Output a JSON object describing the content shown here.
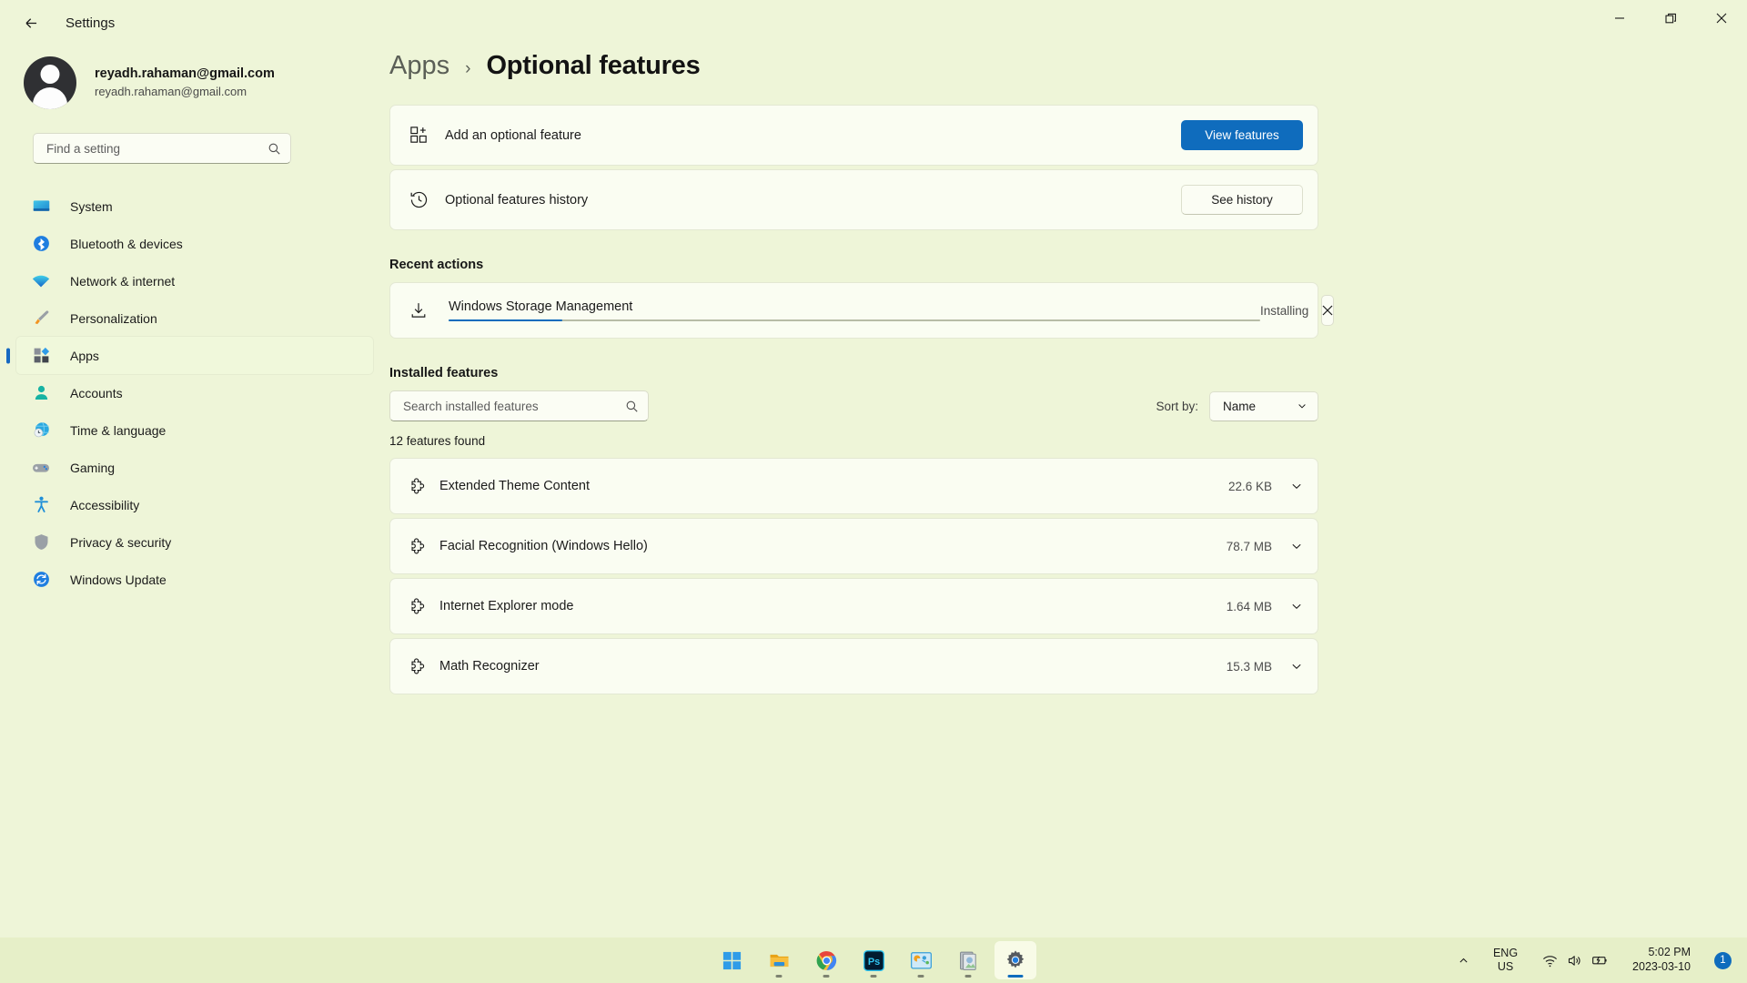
{
  "window": {
    "title": "Settings",
    "back_icon": "arrow-left-icon",
    "minimize_label": "–",
    "maximize_label": "❐",
    "close_label": "✕"
  },
  "account": {
    "name": "reyadh.rahaman@gmail.com",
    "email": "reyadh.rahaman@gmail.com"
  },
  "search": {
    "placeholder": "Find a setting"
  },
  "sidebar": {
    "items": [
      {
        "label": "System",
        "icon": "system-monitor-icon",
        "active": false
      },
      {
        "label": "Bluetooth & devices",
        "icon": "bluetooth-icon",
        "active": false
      },
      {
        "label": "Network & internet",
        "icon": "wifi-icon",
        "active": false
      },
      {
        "label": "Personalization",
        "icon": "paintbrush-icon",
        "active": false
      },
      {
        "label": "Apps",
        "icon": "apps-grid-icon",
        "active": true
      },
      {
        "label": "Accounts",
        "icon": "person-icon",
        "active": false
      },
      {
        "label": "Time & language",
        "icon": "clock-globe-icon",
        "active": false
      },
      {
        "label": "Gaming",
        "icon": "gamepad-icon",
        "active": false
      },
      {
        "label": "Accessibility",
        "icon": "accessibility-person-icon",
        "active": false
      },
      {
        "label": "Privacy & security",
        "icon": "shield-icon",
        "active": false
      },
      {
        "label": "Windows Update",
        "icon": "update-refresh-icon",
        "active": false
      }
    ]
  },
  "breadcrumb": {
    "parent": "Apps",
    "separator": "›",
    "current": "Optional features"
  },
  "cards": {
    "add_feature": {
      "label": "Add an optional feature",
      "icon": "add-grid-icon",
      "button": "View features"
    },
    "history": {
      "label": "Optional features history",
      "icon": "history-clock-icon",
      "button": "See history"
    }
  },
  "recent_actions": {
    "title": "Recent actions",
    "items": [
      {
        "name": "Windows Storage Management",
        "icon": "download-icon",
        "status": "Installing",
        "progress_percent": 14,
        "cancel_icon": "close-icon"
      }
    ]
  },
  "installed": {
    "title": "Installed features",
    "search_placeholder": "Search installed features",
    "search_icon": "search-icon",
    "sort_label": "Sort by:",
    "sort_value": "Name",
    "sort_chevron": "chevron-down-icon",
    "count_text": "12 features found",
    "rows": [
      {
        "name": "Extended Theme Content",
        "size": "22.6 KB",
        "icon": "puzzle-piece-icon"
      },
      {
        "name": "Facial Recognition (Windows Hello)",
        "size": "78.7 MB",
        "icon": "puzzle-piece-icon"
      },
      {
        "name": "Internet Explorer mode",
        "size": "1.64 MB",
        "icon": "puzzle-piece-icon"
      },
      {
        "name": "Math Recognizer",
        "size": "15.3 MB",
        "icon": "puzzle-piece-icon"
      }
    ]
  },
  "taskbar": {
    "items": [
      {
        "name": "start-button",
        "icon": "windows-logo-icon",
        "running": false,
        "active": false
      },
      {
        "name": "file-explorer",
        "icon": "folder-icon",
        "running": true,
        "active": false
      },
      {
        "name": "google-chrome",
        "icon": "chrome-icon",
        "running": true,
        "active": false
      },
      {
        "name": "photoshop",
        "icon": "photoshop-icon",
        "running": true,
        "active": false
      },
      {
        "name": "presentation-app",
        "icon": "presentation-icon",
        "running": true,
        "active": false
      },
      {
        "name": "media-app",
        "icon": "media-icon",
        "running": true,
        "active": false
      },
      {
        "name": "settings-app",
        "icon": "gear-icon",
        "running": true,
        "active": true
      }
    ],
    "tray": {
      "overflow_icon": "chevron-up-icon",
      "language_top": "ENG",
      "language_bottom": "US",
      "wifi_icon": "wifi-icon",
      "volume_icon": "speaker-icon",
      "battery_icon": "battery-charging-icon",
      "time": "5:02 PM",
      "date": "2023-03-10",
      "notification_count": "1"
    }
  },
  "colors": {
    "accent": "#0f6cbd",
    "page_bg": "#eef5d8",
    "card_bg": "#fafdf2"
  }
}
